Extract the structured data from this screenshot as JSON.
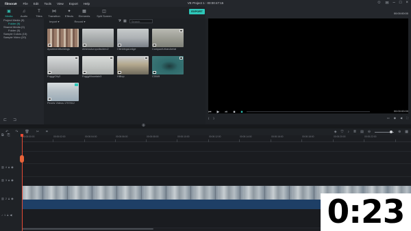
{
  "app": {
    "name": "filmora9",
    "project_title": "VE Project 1 : 00:00:47:15"
  },
  "menu": [
    "File",
    "Edit",
    "Tools",
    "View",
    "Export",
    "Help"
  ],
  "tabs": [
    {
      "label": "Media",
      "icon": "folder-icon",
      "active": true
    },
    {
      "label": "Audio",
      "icon": "music-icon"
    },
    {
      "label": "Titles",
      "icon": "text-icon"
    },
    {
      "label": "Transition",
      "icon": "transition-icon"
    },
    {
      "label": "Effects",
      "icon": "effects-icon"
    },
    {
      "label": "Elements",
      "icon": "elements-icon"
    },
    {
      "label": "Split Screen",
      "icon": "split-screen-icon"
    }
  ],
  "export_label": "EXPORT",
  "tree": [
    {
      "label": "Project Media (9)",
      "sub": false
    },
    {
      "label": "Folder (9)",
      "sub": true,
      "active": true
    },
    {
      "label": "Shared Media (0)",
      "sub": false
    },
    {
      "label": "Folder (0)",
      "sub": true
    },
    {
      "label": "Sample Colors (15)",
      "sub": false
    },
    {
      "label": "Sample Video (20)",
      "sub": false
    }
  ],
  "media_toolbar": {
    "import": "Import",
    "record": "Record",
    "search_placeholder": "Search"
  },
  "clips": [
    {
      "name": "ApartmentBuildings",
      "colors": [
        "#9a7c6a",
        "#c9b8a6"
      ]
    },
    {
      "name": "AthensAcropolisvideo2",
      "colors": [
        "#a3a7a8",
        "#d0d3d0"
      ]
    },
    {
      "name": "ClimbingaLedge",
      "colors": [
        "#7a8088",
        "#c6cacb"
      ]
    },
    {
      "name": "CompactUrbanAerial",
      "colors": [
        "#7e8078",
        "#b9bab3"
      ]
    },
    {
      "name": "FoggyCity2",
      "colors": [
        "#9ea2a2",
        "#d8dadb"
      ]
    },
    {
      "name": "FoggyMountain3",
      "colors": [
        "#a6aaa8",
        "#d8dbd9"
      ]
    },
    {
      "name": "Hilltop",
      "colors": [
        "#6e6a5c",
        "#b5a98f"
      ]
    },
    {
      "name": "C0049",
      "colors": [
        "#3f7a7a",
        "#1f3a3c"
      ]
    },
    {
      "name": "Pexels Videos 1757812",
      "colors": [
        "#9aaab6",
        "#d7dde0"
      ]
    }
  ],
  "preview": {
    "timecode_top": "00:00:00:00",
    "timecode": "00:00:00:00"
  },
  "ruler": [
    "00:00:00:00",
    "00:00:02:00",
    "00:00:04:00",
    "00:00:06:00",
    "00:00:08:00",
    "00:00:10:00",
    "00:00:12:00",
    "00:00:14:00",
    "00:00:16:00",
    "00:00:18:00",
    "00:00:20:00",
    "00:00:22:00"
  ],
  "tracks": [
    {
      "label": "4"
    },
    {
      "label": "3"
    },
    {
      "label": "2"
    },
    {
      "label": "1"
    }
  ],
  "overlay_timer": "0:23"
}
